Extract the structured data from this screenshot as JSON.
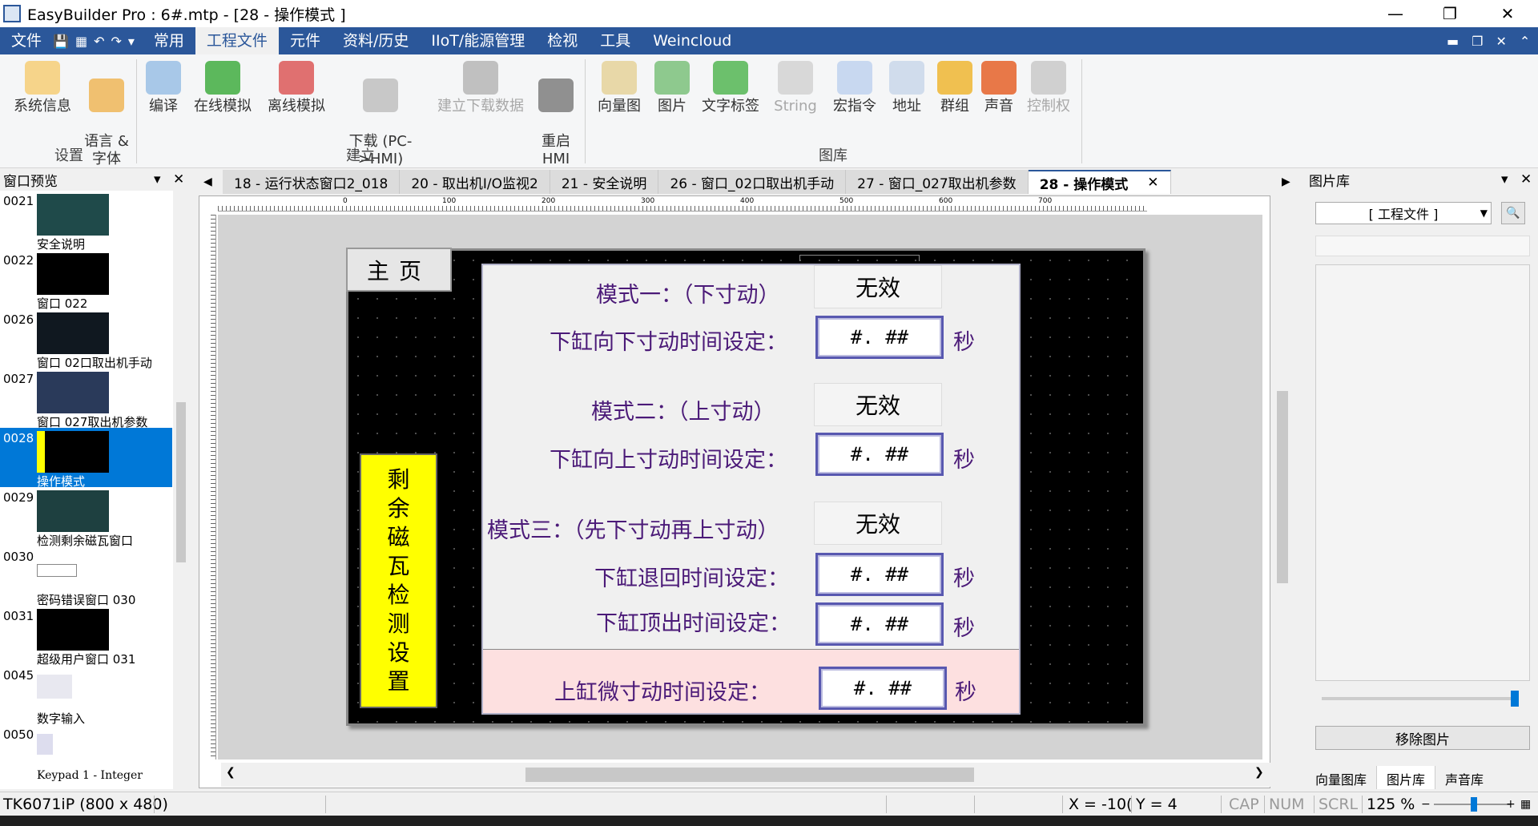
{
  "window": {
    "title": "EasyBuilder Pro : 6#.mtp - [28 - 操作模式 ]"
  },
  "menu": {
    "items": [
      "文件",
      "常用",
      "工程文件",
      "元件",
      "资料/历史",
      "IIoT/能源管理",
      "检视",
      "工具",
      "Weincloud"
    ],
    "active": "工程文件"
  },
  "ribbon": {
    "buttons": [
      {
        "label": "系统信息",
        "enabled": true,
        "icon": "system-info-icon"
      },
      {
        "label": "语言 &\n字体",
        "enabled": true,
        "icon": "language-font-icon"
      },
      {
        "label": "编译",
        "enabled": true,
        "icon": "compile-icon"
      },
      {
        "label": "在线模拟",
        "enabled": true,
        "icon": "online-sim-icon"
      },
      {
        "label": "离线模拟",
        "enabled": true,
        "icon": "offline-sim-icon"
      },
      {
        "label": "下载 (PC-\n>HMI)",
        "enabled": true,
        "icon": "download-icon"
      },
      {
        "label": "建立下载数据",
        "enabled": false,
        "icon": "sd-card-icon"
      },
      {
        "label": "重启\nHMI",
        "enabled": true,
        "icon": "reboot-icon"
      },
      {
        "label": "向量图",
        "enabled": true,
        "icon": "vector-image-icon"
      },
      {
        "label": "图片",
        "enabled": true,
        "icon": "picture-icon"
      },
      {
        "label": "文字标签",
        "enabled": true,
        "icon": "text-tag-icon"
      },
      {
        "label": "String",
        "enabled": false,
        "icon": "string-icon"
      },
      {
        "label": "宏指令",
        "enabled": true,
        "icon": "macro-icon"
      },
      {
        "label": "地址",
        "enabled": true,
        "icon": "address-icon"
      },
      {
        "label": "群组",
        "enabled": true,
        "icon": "group-icon"
      },
      {
        "label": "声音",
        "enabled": true,
        "icon": "sound-icon"
      },
      {
        "label": "控制权",
        "enabled": false,
        "icon": "lock-icon"
      }
    ],
    "groups": [
      "设置",
      "建立",
      "图库"
    ]
  },
  "left_pane": {
    "title": "窗口预览",
    "items": [
      {
        "num": "0021",
        "label": "安全说明"
      },
      {
        "num": "0022",
        "label": "窗口 022"
      },
      {
        "num": "0026",
        "label": "窗口 02口取出机手动"
      },
      {
        "num": "0027",
        "label": "窗口 027取出机参数"
      },
      {
        "num": "0028",
        "label": "操作模式",
        "selected": true
      },
      {
        "num": "0029",
        "label": "检测剩余磁瓦窗口"
      },
      {
        "num": "0030",
        "label": "密码错误窗口 030"
      },
      {
        "num": "0031",
        "label": "超级用户窗口 031"
      },
      {
        "num": "0045",
        "label": "数字输入"
      },
      {
        "num": "0050",
        "label": "Keypad 1 - Integer"
      }
    ]
  },
  "tabs": [
    "18 - 运行状态窗口2_018",
    "20 - 取出机I/O监视2",
    "21 - 安全说明",
    "26 - 窗口_02口取出机手动",
    "27 - 窗口_027取出机参数",
    "28 - 操作模式"
  ],
  "ruler": [
    "0",
    "100",
    "200",
    "300",
    "400",
    "500",
    "600",
    "700"
  ],
  "screen": {
    "home_label": "主页",
    "side_label": [
      "剩",
      "余",
      "磁",
      "瓦",
      "检",
      "测",
      "设",
      "置"
    ],
    "mode1_label": "模式一：（下寸动）",
    "mode1_state": "无效",
    "down_jog_label": "下缸向下寸动时间设定：",
    "mode2_label": "模式二：（上寸动）",
    "mode2_state": "无效",
    "up_jog_label": "下缸向上寸动时间设定：",
    "mode3_label": "模式三：（先下寸动再上寸动）",
    "mode3_state": "无效",
    "retract_label": "下缸退回时间设定：",
    "eject_label": "下缸顶出时间设定：",
    "upper_jog_label": "上缸微寸动时间设定：",
    "num_placeholder": "#. ##",
    "sec_unit": "秒"
  },
  "right_pane": {
    "title": "图片库",
    "dropdown": "[ 工程文件 ]",
    "remove_button": "移除图片",
    "tabs": [
      "向量图库",
      "图片库",
      "声音库"
    ],
    "active_tab": "图片库"
  },
  "status": {
    "device": "TK6071iP (800 x 480)",
    "x": "X = -10(",
    "y": "Y = 4",
    "cap": "CAP",
    "num": "NUM",
    "scrl": "SCRL",
    "zoom": "125 %"
  }
}
